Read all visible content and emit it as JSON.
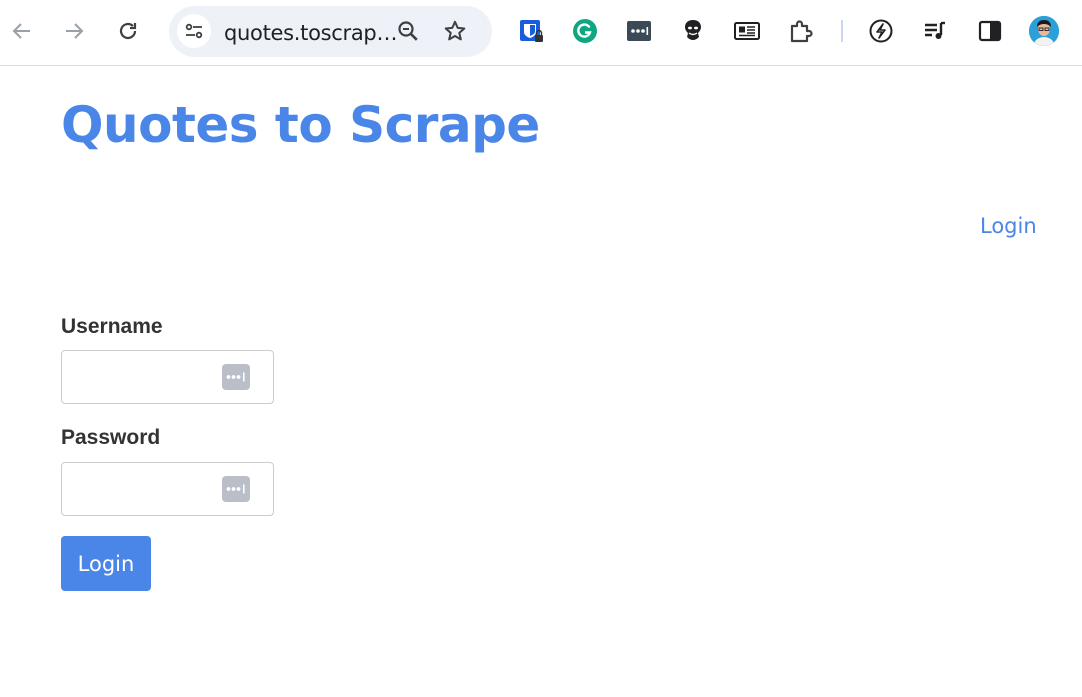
{
  "browser": {
    "url": "quotes.toscrap…",
    "icons": {
      "back": "back-arrow-icon",
      "forward": "forward-arrow-icon",
      "reload": "reload-icon",
      "site_settings": "tune-icon",
      "zoom": "zoom-out-icon",
      "bookmark": "star-icon",
      "side_panel": "side-panel-icon"
    },
    "extensions": [
      "bitwarden",
      "grammarly",
      "password-manager",
      "hacker",
      "news-reader",
      "puzzle",
      "leaf",
      "playlist"
    ],
    "colors": {
      "accent": "#4a86e8",
      "omnibox_bg": "#eef1f7"
    }
  },
  "page": {
    "title": "Quotes to Scrape",
    "header_login": "Login",
    "form": {
      "username_label": "Username",
      "username_value": "",
      "password_label": "Password",
      "password_value": "",
      "submit_label": "Login"
    },
    "colors": {
      "brand": "#4a86e8",
      "text": "#333333"
    }
  }
}
